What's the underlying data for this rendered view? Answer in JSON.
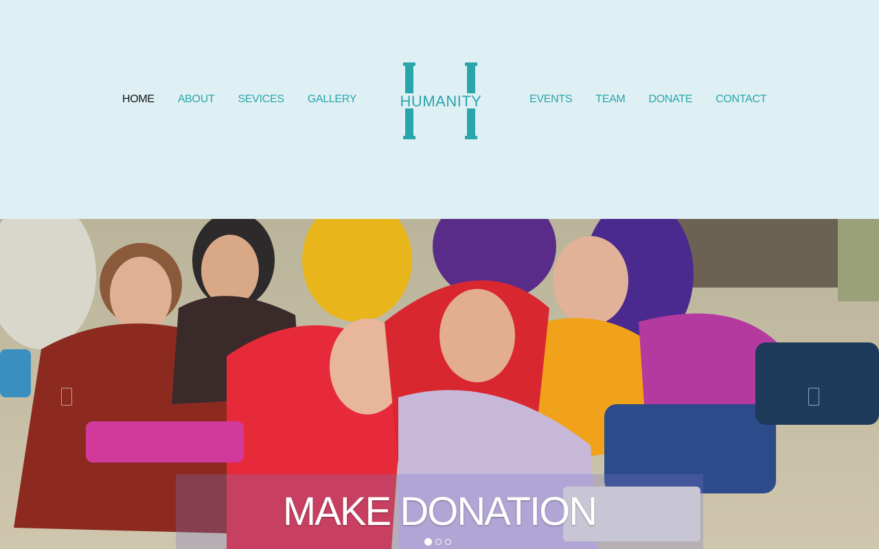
{
  "nav_left": [
    {
      "label": "HOME",
      "active": true
    },
    {
      "label": "ABOUT",
      "active": false
    },
    {
      "label": "SEVICES",
      "active": false
    },
    {
      "label": "GALLERY",
      "active": false
    }
  ],
  "nav_right": [
    {
      "label": "EVENTS",
      "active": false
    },
    {
      "label": "TEAM",
      "active": false
    },
    {
      "label": "DONATE",
      "active": false
    },
    {
      "label": "CONTACT",
      "active": false
    }
  ],
  "logo": {
    "text": "HUMANITY",
    "monogram": "H",
    "color": "#2aa5ab"
  },
  "hero": {
    "image_icon": "photo-of-children-icon",
    "caption": "MAKE DONATION",
    "prev_icon": "chevron-left-icon",
    "next_icon": "chevron-right-icon",
    "slides_total": 3,
    "slide_active": 1
  },
  "colors": {
    "header_bg": "#dff0f4",
    "accent": "#2aa5ab",
    "active_nav": "#111111"
  }
}
